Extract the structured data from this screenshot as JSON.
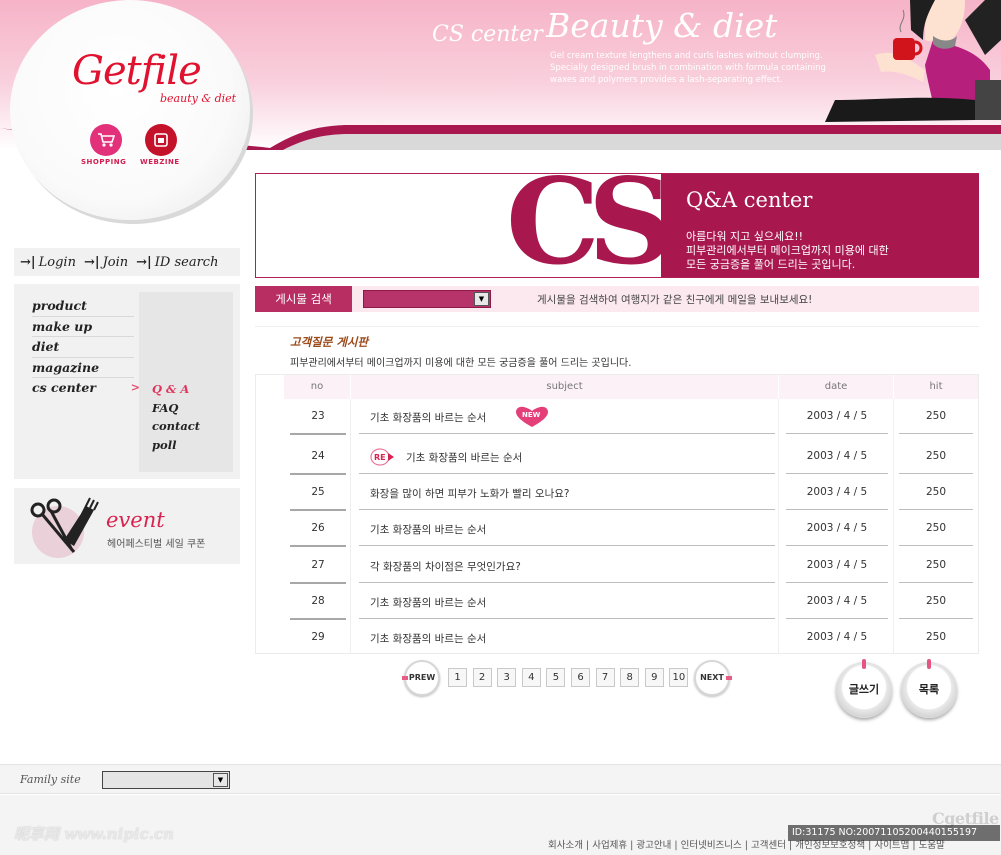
{
  "header": {
    "section_title": "CS center",
    "hero_title": "Beauty & diet",
    "hero_desc": [
      "Gel cream texture lengthens and curls lashes without clumping.",
      "Specially designed brush in combination with formula containing",
      "waxes and polymers provides a lash-separating effect."
    ]
  },
  "logo": {
    "name": "Getfile",
    "tagline": "beauty & diet",
    "menu": [
      {
        "label": "SHOPPING",
        "icon": "shopping-cart-icon"
      },
      {
        "label": "WEBZINE",
        "icon": "webzine-icon"
      }
    ]
  },
  "auth": {
    "login": "Login",
    "join": "Join",
    "id_search": "ID search"
  },
  "sidebar": {
    "nav": [
      "product",
      "make up",
      "diet",
      "magazine",
      "cs center"
    ],
    "active_index": 4,
    "selected_marker": ">",
    "sub_nav": [
      "Q & A",
      "FAQ",
      "contact",
      "poll"
    ],
    "active_sub_index": 0
  },
  "event": {
    "title": "event",
    "subtitle": "헤어페스티벌 세일 쿠폰"
  },
  "banner": {
    "big_text": "CS",
    "title": "Q&A center",
    "lines": [
      "아름다워 지고 싶으세요!!",
      "피부관리에서부터 메이크업까지 미용에 대한",
      "모든 궁금증을 풀어 드리는 곳입니다."
    ]
  },
  "search": {
    "label": "게시물 검색",
    "select_value": "",
    "hint": "게시물을 검색하여 여행지가 같은 친구에게 메일을 보내보세요!"
  },
  "board": {
    "title": "고객질문 게시판",
    "desc": "피부관리에서부터 메이크업까지 미용에 대한 모든 궁금증을 풀어 드리는 곳입니다.",
    "columns": {
      "no": "no",
      "subject": "subject",
      "date": "date",
      "hit": "hit"
    },
    "rows": [
      {
        "no": "23",
        "subject": "기초 화장품의 바르는 순서",
        "date": "2003 / 4 / 5",
        "hit": "250",
        "badge": "NEW"
      },
      {
        "no": "24",
        "subject": "기초 화장품의 바르는 순서",
        "date": "2003 / 4 / 5",
        "hit": "250",
        "badge": "RE"
      },
      {
        "no": "25",
        "subject": "화장을 많이 하면 피부가 노화가 빨리 오나요?",
        "date": "2003 / 4 / 5",
        "hit": "250",
        "badge": ""
      },
      {
        "no": "26",
        "subject": "기초 화장품의 바르는 순서",
        "date": "2003 / 4 / 5",
        "hit": "250",
        "badge": ""
      },
      {
        "no": "27",
        "subject": "각 화장품의 차이점은 무엇인가요?",
        "date": "2003 / 4 / 5",
        "hit": "250",
        "badge": ""
      },
      {
        "no": "28",
        "subject": "기초 화장품의 바르는 순서",
        "date": "2003 / 4 / 5",
        "hit": "250",
        "badge": ""
      },
      {
        "no": "29",
        "subject": "기초 화장품의 바르는 순서",
        "date": "2003 / 4 / 5",
        "hit": "250",
        "badge": ""
      }
    ]
  },
  "pagination": {
    "prev": "PREW",
    "next": "NEXT",
    "pages": [
      "1",
      "2",
      "3",
      "4",
      "5",
      "6",
      "7",
      "8",
      "9",
      "10"
    ]
  },
  "actions": {
    "write": "글쓰기",
    "list": "목록"
  },
  "footer": {
    "family_label": "Family site",
    "family_select_value": "",
    "links": "회사소개 | 사업제휴 | 광고안내 | 인터넷비즈니스 | 고객센터 | 개인정보보호정책 | 사이트맵 | 도움말",
    "logo": "Cgetfile",
    "watermark": "昵享网 www.nipic.cn",
    "image_id": "ID:31175 NO:20071105200440155197"
  },
  "colors": {
    "brand_pink": "#e0122f",
    "accent_magenta": "#a8184f",
    "header_pink": "#f6b3c8"
  }
}
